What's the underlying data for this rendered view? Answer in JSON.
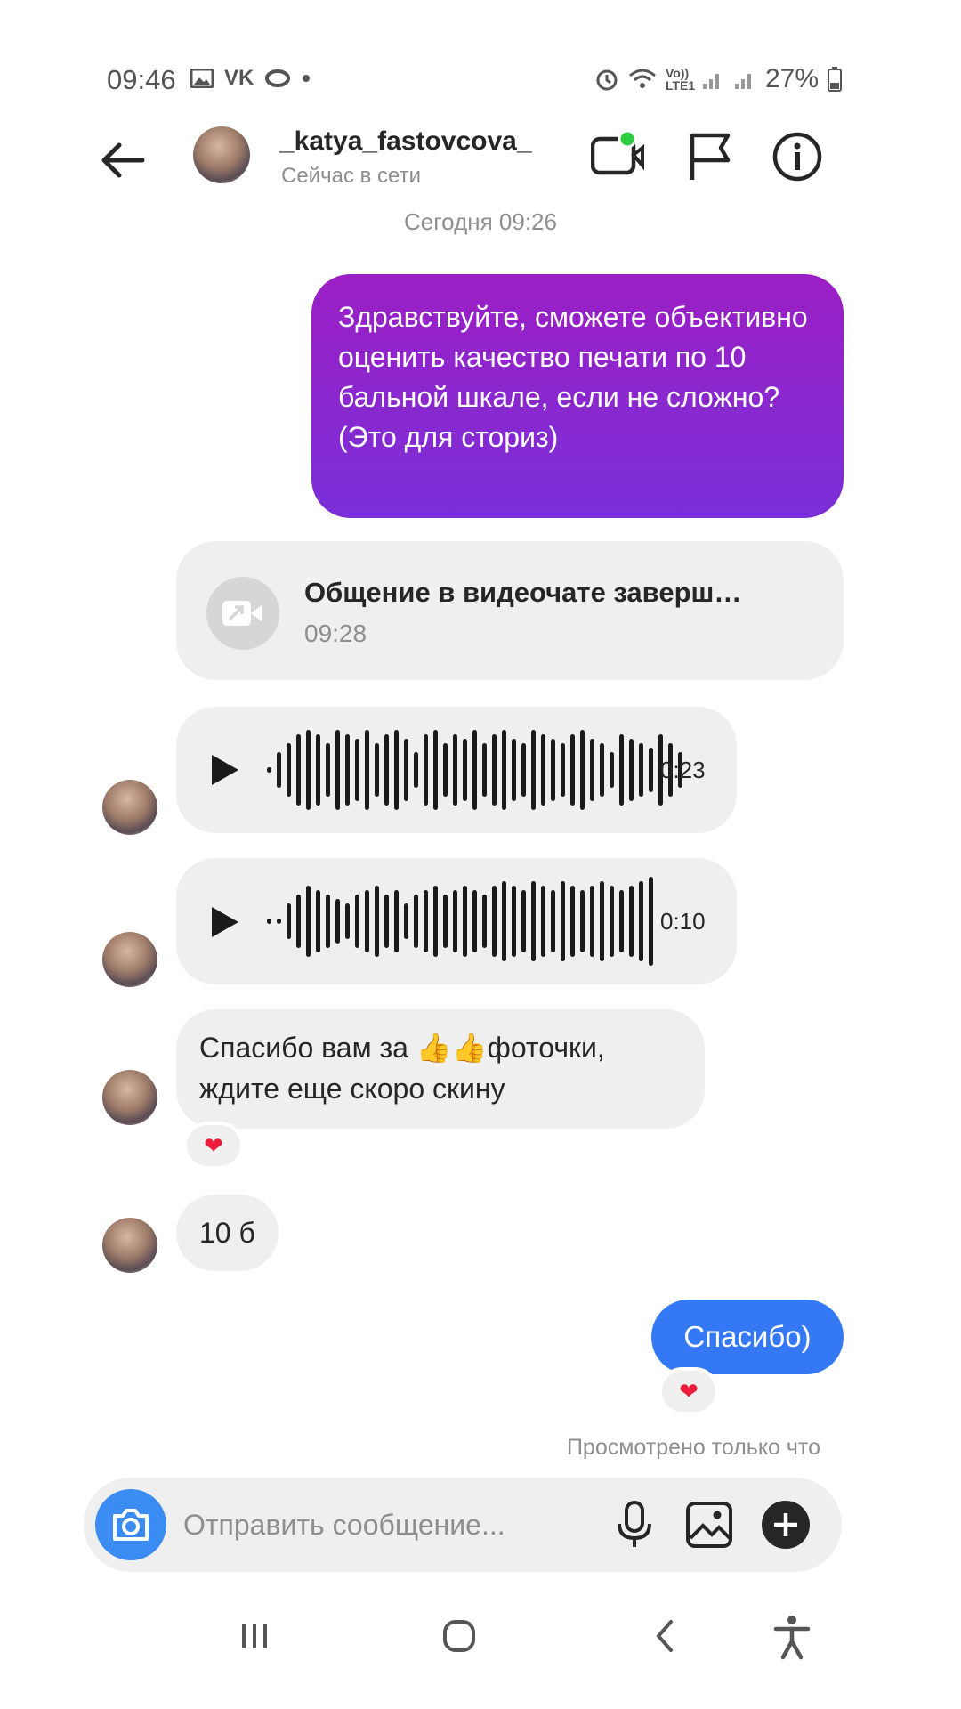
{
  "status_bar": {
    "time": "09:46",
    "battery": "27%",
    "left_icons": [
      "gallery-icon",
      "vk-icon",
      "ok-icon",
      "dot-icon"
    ],
    "right_icons": [
      "alarm-icon",
      "wifi-icon",
      "volte-icon",
      "signal-icon",
      "signal-icon",
      "battery-icon"
    ],
    "volte_label": "Vo)) LTE1"
  },
  "header": {
    "username": "_katya_fastovcova_",
    "status": "Сейчас в сети",
    "online_color": "#2ecc40"
  },
  "chat": {
    "date_stamp": "Сегодня 09:26",
    "outgoing_message": "Здравствуйте, сможете объективно оценить качество печати по 10 бальной шкале, если не сложно? (Это для сториз)",
    "video_chat": {
      "title": "Общение в видеочате заверш…",
      "time": "09:28"
    },
    "voice_messages": [
      {
        "duration": "0:23"
      },
      {
        "duration": "0:10"
      }
    ],
    "incoming_text": "Спасибо вам за 👍👍фоточки, ждите еще скоро скину",
    "incoming_text_reaction": "❤",
    "incoming_short": "10 б",
    "outgoing_thanks": "Спасибо)",
    "outgoing_thanks_reaction": "❤",
    "seen_status": "Просмотрено только что"
  },
  "composer": {
    "placeholder": "Отправить сообщение..."
  },
  "colors": {
    "outgoing_gradient_top": "#9b1fc4",
    "outgoing_gradient_bottom": "#7a2fd8",
    "outgoing_blue": "#3478f6",
    "camera_button": "#3a8cf3",
    "bubble_gray": "#efefef",
    "heart": "#ed1c3d"
  }
}
